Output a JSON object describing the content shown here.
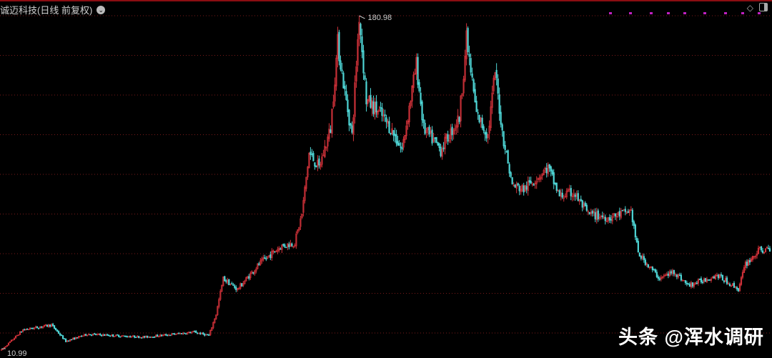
{
  "header": {
    "title": "诚迈科技(日线 前复权)",
    "dropdown_icon": "chevron-down-icon"
  },
  "toolbar": {
    "icons": [
      "diamond-icon",
      "panel-toggle-icon"
    ]
  },
  "watermark": "头条 @浑水调研",
  "colors": {
    "up": "#d2323a",
    "down": "#4fd6d6",
    "grid": "#7a1a1a",
    "marker": "#c020c0"
  },
  "chart_data": {
    "type": "candlestick",
    "title": "诚迈科技(日线 前复权)",
    "max_label": "180.98",
    "min_label": "10.99",
    "ylim": [
      10.99,
      180.98
    ],
    "grid": true,
    "trend_waypoints": [
      [
        0,
        11.0
      ],
      [
        15,
        21.3
      ],
      [
        35,
        23.8
      ],
      [
        45,
        15.5
      ],
      [
        60,
        19.1
      ],
      [
        100,
        17.6
      ],
      [
        135,
        20.2
      ],
      [
        145,
        18.4
      ],
      [
        150,
        29.3
      ],
      [
        155,
        47.4
      ],
      [
        165,
        41.9
      ],
      [
        180,
        54.7
      ],
      [
        195,
        63.7
      ],
      [
        205,
        65.6
      ],
      [
        210,
        80.1
      ],
      [
        215,
        111
      ],
      [
        222,
        103.7
      ],
      [
        230,
        123.6
      ],
      [
        235,
        167.2
      ],
      [
        240,
        141.8
      ],
      [
        245,
        120
      ],
      [
        250,
        180.98
      ],
      [
        255,
        138.2
      ],
      [
        265,
        131
      ],
      [
        272,
        123.6
      ],
      [
        280,
        112.8
      ],
      [
        290,
        156.3
      ],
      [
        295,
        123.6
      ],
      [
        307,
        112.8
      ],
      [
        320,
        129.1
      ],
      [
        325,
        169
      ],
      [
        332,
        130.9
      ],
      [
        340,
        120
      ],
      [
        345,
        152.7
      ],
      [
        350,
        121.8
      ],
      [
        357,
        94.6
      ],
      [
        365,
        92.8
      ],
      [
        382,
        103.7
      ],
      [
        390,
        89.2
      ],
      [
        400,
        91
      ],
      [
        410,
        80.1
      ],
      [
        425,
        78.3
      ],
      [
        440,
        81.9
      ],
      [
        445,
        60.1
      ],
      [
        460,
        47.4
      ],
      [
        470,
        51
      ],
      [
        480,
        43.8
      ],
      [
        500,
        49.2
      ],
      [
        515,
        42
      ],
      [
        520,
        54.7
      ],
      [
        530,
        61.9
      ],
      [
        537,
        61.9
      ]
    ]
  }
}
